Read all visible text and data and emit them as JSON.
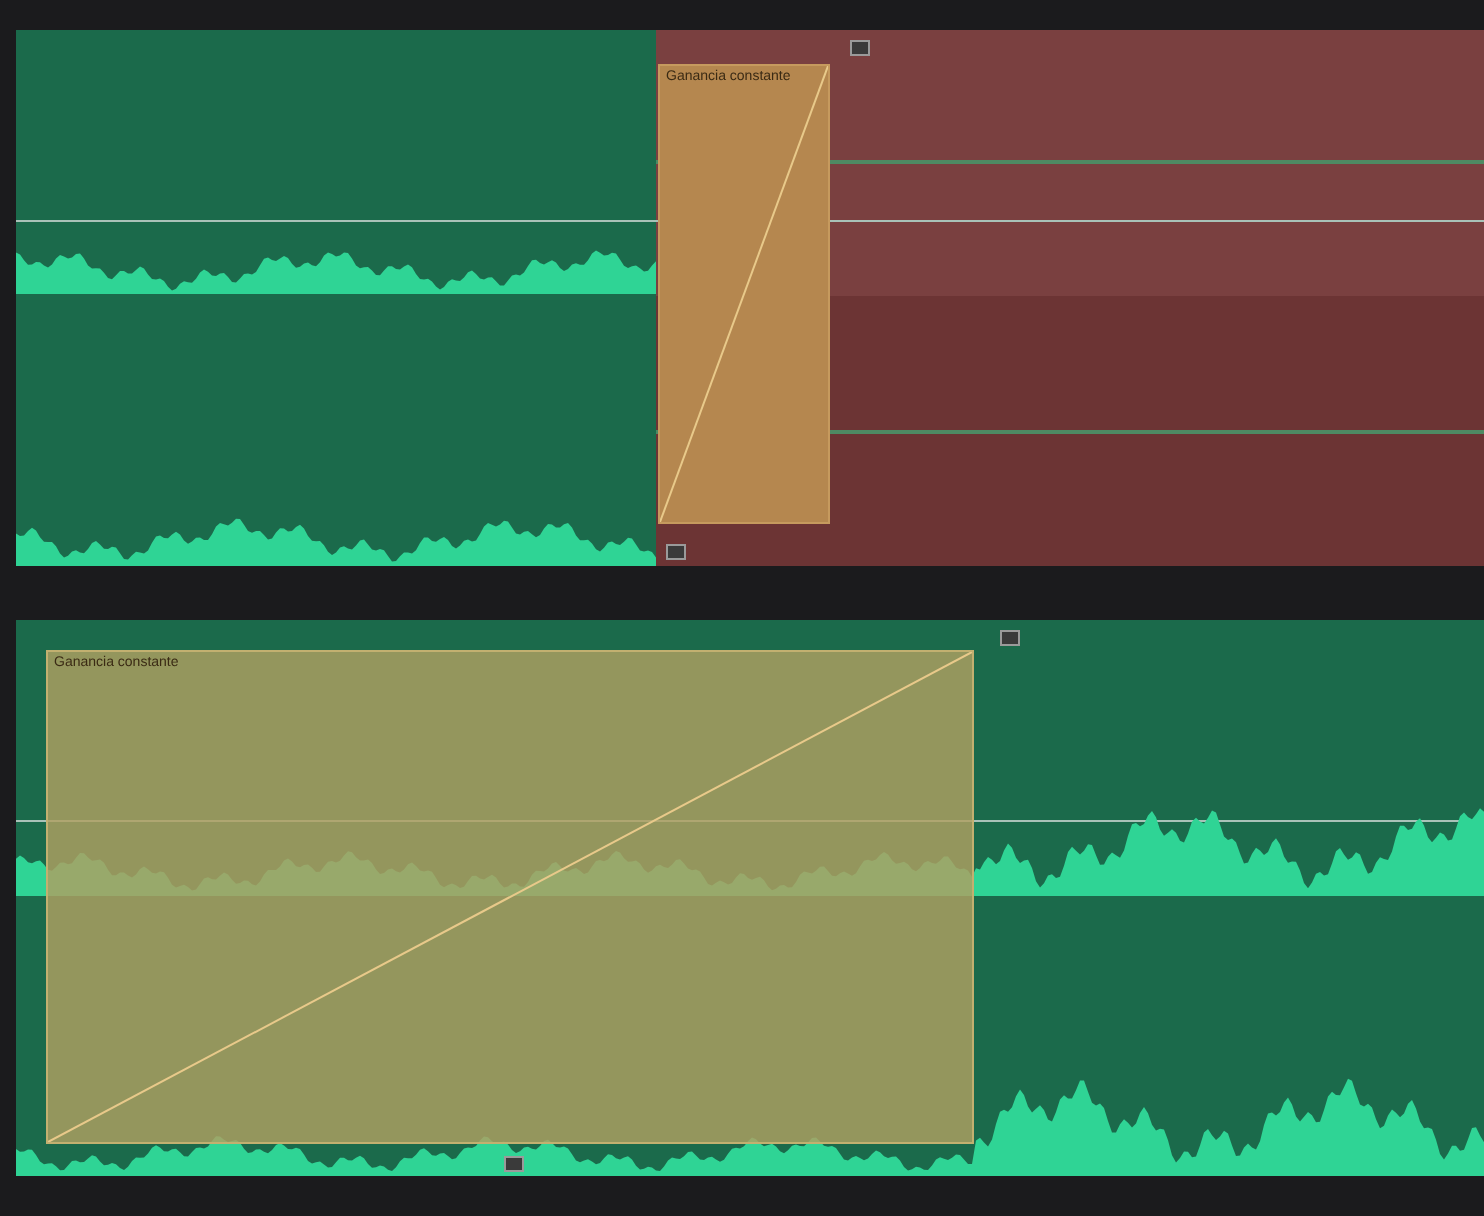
{
  "tracks": [
    {
      "clips": [
        {
          "color": "#1b6a4b"
        },
        {
          "color": "#7a4040"
        }
      ],
      "transition": {
        "label": "Ganancia constante"
      }
    },
    {
      "clips": [
        {
          "color": "#1b6a4b"
        }
      ],
      "transition": {
        "label": "Ganancia constante"
      }
    }
  ]
}
